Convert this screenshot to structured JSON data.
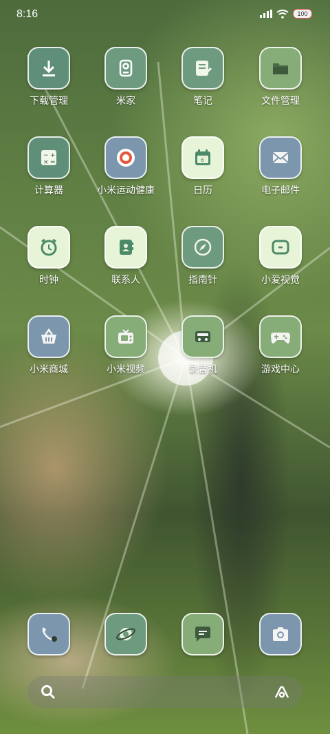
{
  "status_bar": {
    "time": "8:16",
    "battery": "100"
  },
  "apps": [
    {
      "label": "下载管理",
      "icon": "download-icon",
      "color": "#5f8f78"
    },
    {
      "label": "米家",
      "icon": "mijia-icon",
      "color": "#6e9b80"
    },
    {
      "label": "笔记",
      "icon": "notes-icon",
      "color": "#6e9b80"
    },
    {
      "label": "文件管理",
      "icon": "folder-icon",
      "color": "#86ad78"
    },
    {
      "label": "计算器",
      "icon": "calculator-icon",
      "color": "#5f8f78"
    },
    {
      "label": "小米运动健康",
      "icon": "fitness-icon",
      "color": "#7c97ad"
    },
    {
      "label": "日历",
      "icon": "calendar-icon",
      "color": "#e8f4d8"
    },
    {
      "label": "电子邮件",
      "icon": "mail-icon",
      "color": "#7c97ad"
    },
    {
      "label": "时钟",
      "icon": "clock-icon",
      "color": "#e8f4d8"
    },
    {
      "label": "联系人",
      "icon": "contacts-icon",
      "color": "#e8f4d8"
    },
    {
      "label": "指南针",
      "icon": "compass-icon",
      "color": "#6e9b80"
    },
    {
      "label": "小爱视觉",
      "icon": "scan-icon",
      "color": "#e8f4d8"
    },
    {
      "label": "小米商城",
      "icon": "shop-basket-icon",
      "color": "#7c97ad"
    },
    {
      "label": "小米视频",
      "icon": "video-icon",
      "color": "#86ad78"
    },
    {
      "label": "录音机",
      "icon": "recorder-icon",
      "color": "#86ad78"
    },
    {
      "label": "游戏中心",
      "icon": "gamepad-icon",
      "color": "#86ad78"
    }
  ],
  "dock": [
    {
      "icon": "phone-icon",
      "color": "#7c97ad"
    },
    {
      "icon": "browser-icon",
      "color": "#6e9b80"
    },
    {
      "icon": "messages-icon",
      "color": "#86ad78"
    },
    {
      "icon": "camera-icon",
      "color": "#7c97ad"
    }
  ]
}
